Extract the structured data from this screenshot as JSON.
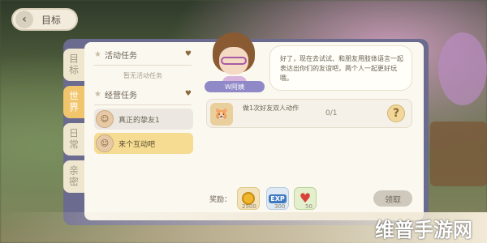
{
  "header": {
    "back_label": "目标"
  },
  "tabs": [
    {
      "label": "目标",
      "active": false
    },
    {
      "label": "世界",
      "active": true
    },
    {
      "label": "日常",
      "active": false
    },
    {
      "label": "亲密",
      "active": false
    }
  ],
  "sections": {
    "activity": {
      "title": "活动任务",
      "empty_text": "暂无活动任务"
    },
    "business": {
      "title": "经营任务",
      "items": [
        {
          "label": "真正的挚友1",
          "active": false
        },
        {
          "label": "来个互动吧",
          "active": true
        }
      ]
    }
  },
  "npc": {
    "name": "W阿姨",
    "dialog": "好了，现在去试试、和朋友用肢体语言一起表达出你们的友谊吧，两个人一起更好玩哦。"
  },
  "task": {
    "description": "做1次好友双人动作",
    "progress": "0/1",
    "help_symbol": "?"
  },
  "rewards": {
    "label": "奖励：",
    "items": [
      {
        "icon": "gold-coin-icon",
        "count": "2500"
      },
      {
        "icon": "exp-icon",
        "badge": "EXP",
        "count": "300"
      },
      {
        "icon": "heart-icon",
        "count": "50"
      }
    ],
    "claim_label": "领取"
  },
  "watermark": "维普手游网",
  "colors": {
    "active_tab": "#f1c56b",
    "active_item": "#f6dc92",
    "panel": "#fbf8f0",
    "frame": "#6b6b8f"
  }
}
